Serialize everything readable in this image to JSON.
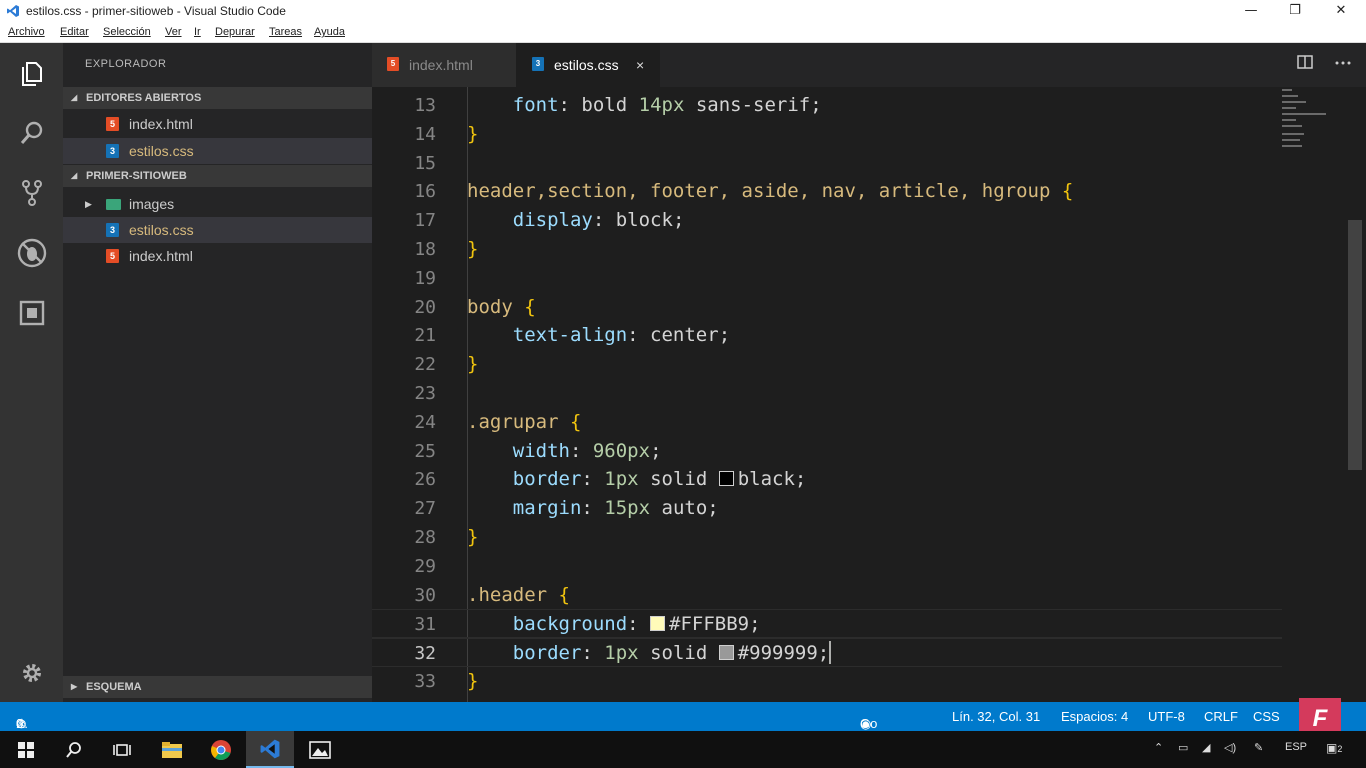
{
  "window": {
    "title": "estilos.css - primer-sitioweb - Visual Studio Code",
    "minimize": "—",
    "maximize": "❐",
    "close": "✕"
  },
  "menu": [
    "Archivo",
    "Editar",
    "Selección",
    "Ver",
    "Ir",
    "Depurar",
    "Tareas",
    "Ayuda"
  ],
  "sidebar": {
    "title": "EXPLORADOR",
    "open_editors": {
      "label": "EDITORES ABIERTOS",
      "items": [
        {
          "label": "index.html",
          "type": "html"
        },
        {
          "label": "estilos.css",
          "type": "css"
        }
      ]
    },
    "project": {
      "label": "PRIMER-SITIOWEB",
      "items": [
        {
          "label": "images",
          "type": "folder"
        },
        {
          "label": "estilos.css",
          "type": "css"
        },
        {
          "label": "index.html",
          "type": "html"
        }
      ]
    },
    "outline": {
      "label": "ESQUEMA"
    }
  },
  "tabs": [
    {
      "label": "index.html",
      "active": false
    },
    {
      "label": "estilos.css",
      "active": true,
      "close": "×"
    }
  ],
  "file_icons": {
    "html": "5",
    "css": "3"
  },
  "editor": {
    "lines": [
      {
        "n": "13",
        "code": "    font: bold 14px sans-serif;"
      },
      {
        "n": "14",
        "code": "}"
      },
      {
        "n": "15",
        "code": ""
      },
      {
        "n": "16",
        "code": "header,section, footer, aside, nav, article, hgroup {"
      },
      {
        "n": "17",
        "code": "    display: block;"
      },
      {
        "n": "18",
        "code": "}"
      },
      {
        "n": "19",
        "code": ""
      },
      {
        "n": "20",
        "code": "body {"
      },
      {
        "n": "21",
        "code": "    text-align: center;"
      },
      {
        "n": "22",
        "code": "}"
      },
      {
        "n": "23",
        "code": ""
      },
      {
        "n": "24",
        "code": ".agrupar {"
      },
      {
        "n": "25",
        "code": "    width: 960px;"
      },
      {
        "n": "26",
        "code": "    border: 1px solid black;"
      },
      {
        "n": "27",
        "code": "    margin: 15px auto;"
      },
      {
        "n": "28",
        "code": "}"
      },
      {
        "n": "29",
        "code": ""
      },
      {
        "n": "30",
        "code": ".header {"
      },
      {
        "n": "31",
        "code": "    background: #FFFBB9;"
      },
      {
        "n": "32",
        "code": "    border: 1px solid #999999;"
      },
      {
        "n": "33",
        "code": "}"
      }
    ],
    "current_line": "32"
  },
  "status": {
    "errors": "0",
    "warnings": "0",
    "go_live": "Go Live",
    "position": "Lín. 32, Col. 31",
    "spaces": "Espacios: 4",
    "encoding": "UTF-8",
    "eol": "CRLF",
    "language": "CSS"
  },
  "taskbar": {
    "tray_lang": "ESP",
    "notifications": "2"
  },
  "watermark": "F",
  "colors": {
    "statusbar": "#007acc",
    "selector": "#d7ba7d",
    "property": "#9cdcfe",
    "number": "#b5cea8",
    "brace": "#f1c40f",
    "swatch_black": "#000000",
    "swatch_cream": "#FFFBB9",
    "swatch_gray": "#999999"
  }
}
